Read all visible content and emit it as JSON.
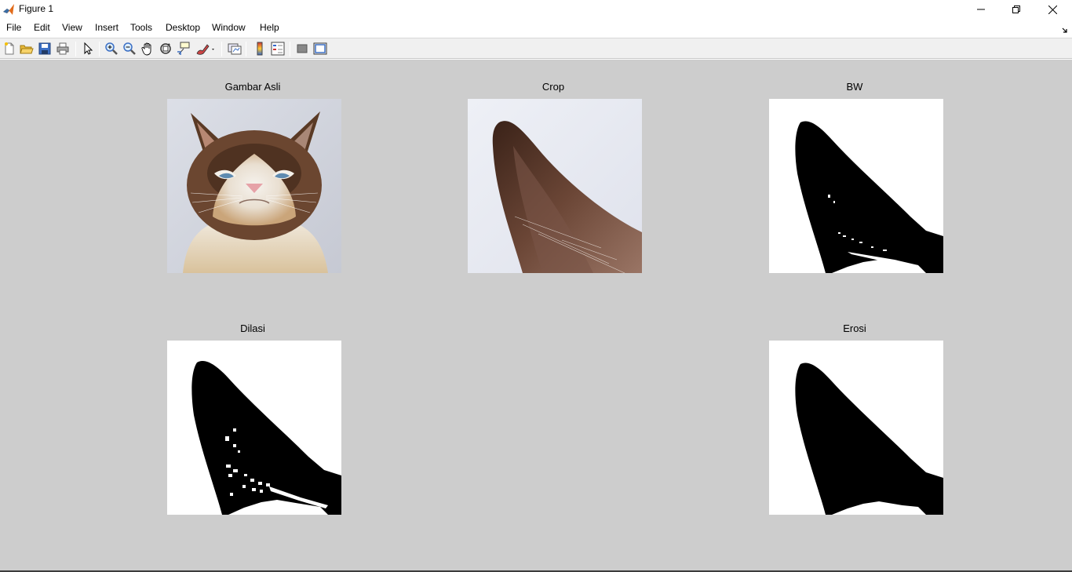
{
  "window": {
    "title": "Figure 1"
  },
  "menu": [
    "File",
    "Edit",
    "View",
    "Insert",
    "Tools",
    "Desktop",
    "Window",
    "Help"
  ],
  "toolbar_icons": [
    "new-figure-icon",
    "open-file-icon",
    "save-icon",
    "print-icon",
    "edit-plot-icon",
    "zoom-in-icon",
    "zoom-out-icon",
    "pan-icon",
    "rotate-3d-icon",
    "data-cursor-icon",
    "brush-icon",
    "link-plot-icon",
    "colorbar-icon",
    "legend-icon",
    "hide-plot-tools-icon",
    "show-plot-tools-icon"
  ],
  "subplots": {
    "original": {
      "title": "Gambar Asli"
    },
    "crop": {
      "title": "Crop"
    },
    "bw": {
      "title": "BW"
    },
    "dilation": {
      "title": "Dilasi"
    },
    "erosion": {
      "title": "Erosi"
    }
  },
  "colors": {
    "figure_bg": "#cdcdcd",
    "toolbar_bg": "#f0f0f0",
    "matlab_orange": "#e16b1a"
  }
}
